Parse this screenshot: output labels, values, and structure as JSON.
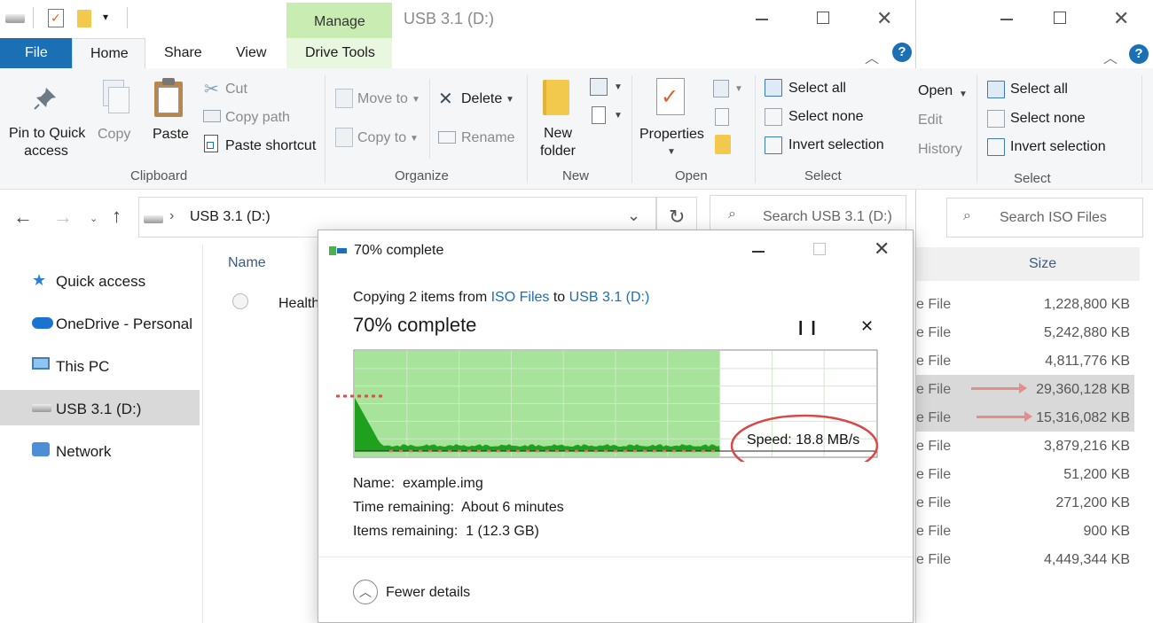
{
  "back_window": {
    "ribbon": {
      "open_label": "Open",
      "edit_label": "Edit",
      "history_label": "History",
      "select_all_label": "Select all",
      "select_none_label": "Select none",
      "invert_selection_label": "Invert selection",
      "select_group_label": "Select"
    },
    "search_placeholder": "Search ISO Files",
    "size_header": "Size",
    "rows": [
      {
        "type_suffix": "e File",
        "size": "1,228,800 KB",
        "highlighted": false
      },
      {
        "type_suffix": "e File",
        "size": "5,242,880 KB",
        "highlighted": false
      },
      {
        "type_suffix": "e File",
        "size": "4,811,776 KB",
        "highlighted": false
      },
      {
        "type_suffix": "e File",
        "size": "29,360,128 KB",
        "highlighted": true
      },
      {
        "type_suffix": "e File",
        "size": "15,316,082 KB",
        "highlighted": true
      },
      {
        "type_suffix": "e File",
        "size": "3,879,216 KB",
        "highlighted": false
      },
      {
        "type_suffix": "e File",
        "size": "51,200 KB",
        "highlighted": false
      },
      {
        "type_suffix": "e File",
        "size": "271,200 KB",
        "highlighted": false
      },
      {
        "type_suffix": "e File",
        "size": "900 KB",
        "highlighted": false
      },
      {
        "type_suffix": "e File",
        "size": "4,449,344 KB",
        "highlighted": false
      }
    ]
  },
  "front_window": {
    "title": "USB 3.1 (D:)",
    "contextual_tab_group": "Manage",
    "tabs": {
      "file": "File",
      "home": "Home",
      "share": "Share",
      "view": "View",
      "drive_tools": "Drive Tools"
    },
    "ribbon": {
      "pin_label": "Pin to Quick\naccess",
      "pin_line1": "Pin to Quick",
      "pin_line2": "access",
      "copy_label": "Copy",
      "paste_label": "Paste",
      "cut_label": "Cut",
      "copy_path_label": "Copy path",
      "paste_shortcut_label": "Paste shortcut",
      "clipboard_group": "Clipboard",
      "move_to_label": "Move to",
      "copy_to_label": "Copy to",
      "delete_label": "Delete",
      "rename_label": "Rename",
      "organize_group": "Organize",
      "new_folder_line1": "New",
      "new_folder_line2": "folder",
      "new_group": "New",
      "properties_label": "Properties",
      "open_group": "Open",
      "select_all_label": "Select all",
      "select_none_label": "Select none",
      "invert_selection_label": "Invert selection",
      "select_group": "Select"
    },
    "address": "USB 3.1 (D:)",
    "search_placeholder": "Search USB 3.1 (D:)",
    "nav": [
      {
        "label": "Quick access"
      },
      {
        "label": "OneDrive - Personal"
      },
      {
        "label": "This PC"
      },
      {
        "label": "USB 3.1 (D:)",
        "selected": true
      },
      {
        "label": "Network"
      }
    ],
    "column_name": "Name",
    "file_row_name": "Health"
  },
  "dialog": {
    "title": "70% complete",
    "copying_prefix": "Copying 2 items from ",
    "source": "ISO Files",
    "to_word": " to ",
    "destination": "USB 3.1 (D:)",
    "heading": "70% complete",
    "progress_percent": 70,
    "speed_label": "Speed: 18.8 MB/s",
    "name_label": "Name:",
    "name_value": "example.img",
    "time_label": "Time remaining:",
    "time_value": "About 6 minutes",
    "items_label": "Items remaining:",
    "items_value": "1 (12.3 GB)",
    "fewer_details": "Fewer details"
  }
}
